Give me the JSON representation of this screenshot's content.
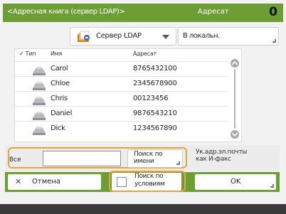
{
  "header": {
    "title": "<Адресная книга (сервер LDAP)>",
    "recipient_label": "Адресат",
    "recipient_count": "0",
    "color": "#6d9e35"
  },
  "toolbar": {
    "server_select": {
      "label": "Сервер LDAP",
      "icon": "address-book-icon"
    },
    "local_button": {
      "label": "В локальн."
    }
  },
  "list": {
    "columns": {
      "type": "Тип",
      "name": "Имя",
      "address": "Адресат"
    },
    "rows": [
      {
        "icon": "fax-icon",
        "name": "Carol",
        "address": "8765432100"
      },
      {
        "icon": "fax-icon",
        "name": "Chloe",
        "address": "2345678900"
      },
      {
        "icon": "fax-icon",
        "name": "Chris",
        "address": "00123456"
      },
      {
        "icon": "fax-icon",
        "name": "Daniel",
        "address": "9876543210"
      },
      {
        "icon": "fax-icon",
        "name": "Dick",
        "address": "1234567890"
      }
    ]
  },
  "search": {
    "all_label": "Все",
    "input_value": "",
    "search_by_name": "Поиск по\nимени",
    "ifax_label": "Ук.адр.эл.почты\nкак И-факс"
  },
  "actions": {
    "cancel": "Отмена",
    "search_by_condition": "Поиск по\nусловиям",
    "ok": "OK"
  },
  "accent_color": "#e8a33a"
}
